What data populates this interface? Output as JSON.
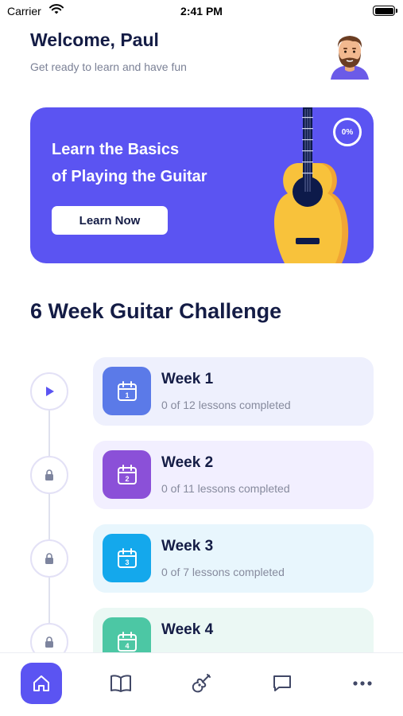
{
  "status_bar": {
    "carrier": "Carrier",
    "time": "2:41 PM"
  },
  "header": {
    "greeting": "Welcome, Paul",
    "subtitle": "Get ready to learn and have fun",
    "avatar_icon": "bearded-man-avatar"
  },
  "hero": {
    "line1": "Learn the Basics",
    "line2": "of Playing the Guitar",
    "button_label": "Learn Now",
    "progress": "0%",
    "background": "#5b54f2",
    "image_icon": "acoustic-guitar"
  },
  "challenge": {
    "title": "6 Week Guitar Challenge",
    "weeks": [
      {
        "title": "Week 1",
        "subtitle": "0 of 12 lessons completed",
        "day": "1",
        "status": "play",
        "card_color": "#eef0fd",
        "icon_color": "#5b7ae8"
      },
      {
        "title": "Week 2",
        "subtitle": "0 of 11 lessons completed",
        "day": "2",
        "status": "locked",
        "card_color": "#f2efff",
        "icon_color": "#8b50d8"
      },
      {
        "title": "Week 3",
        "subtitle": "0 of 7 lessons completed",
        "day": "3",
        "status": "locked",
        "card_color": "#e8f6fd",
        "icon_color": "#14a8ec"
      },
      {
        "title": "Week 4",
        "subtitle": "",
        "day": "4",
        "status": "locked",
        "card_color": "#ebf8f4",
        "icon_color": "#4cc7a4"
      }
    ]
  },
  "tab_bar": {
    "tabs": [
      {
        "icon": "home-icon",
        "active": true
      },
      {
        "icon": "book-icon",
        "active": false
      },
      {
        "icon": "guitar-icon",
        "active": false
      },
      {
        "icon": "chat-icon",
        "active": false
      },
      {
        "icon": "more-icon",
        "active": false
      }
    ],
    "accent": "#5b54f2"
  }
}
